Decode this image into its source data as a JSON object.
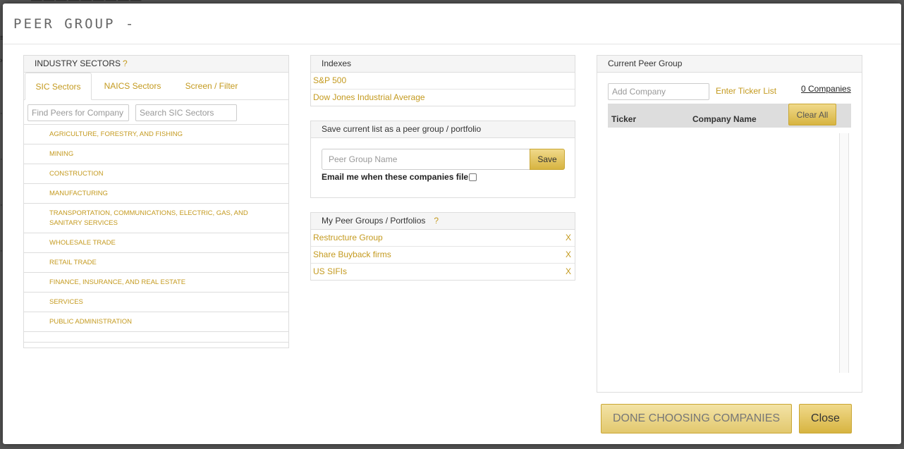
{
  "modal": {
    "title": "PEER GROUP -"
  },
  "industry": {
    "title": "INDUSTRY SECTORS",
    "help": "?",
    "tabs": [
      "SIC Sectors",
      "NAICS Sectors",
      "Screen / Filter"
    ],
    "find_peers_placeholder": "Find Peers for Company",
    "search_sic_placeholder": "Search SIC Sectors",
    "sectors": [
      "AGRICULTURE, FORESTRY, AND FISHING",
      "MINING",
      "CONSTRUCTION",
      "MANUFACTURING",
      "TRANSPORTATION, COMMUNICATIONS, ELECTRIC, GAS, AND SANITARY SERVICES",
      "WHOLESALE TRADE",
      "RETAIL TRADE",
      "FINANCE, INSURANCE, AND REAL ESTATE",
      "SERVICES",
      "PUBLIC ADMINISTRATION"
    ]
  },
  "indexes": {
    "title": "Indexes",
    "items": [
      "S&P 500",
      "Dow Jones Industrial Average"
    ]
  },
  "save_panel": {
    "title": "Save current list as a peer group / portfolio",
    "name_placeholder": "Peer Group Name",
    "save_label": "Save",
    "email_label": "Email me when these companies file"
  },
  "my_groups": {
    "title": "My Peer Groups / Portfolios",
    "help": "?",
    "items": [
      "Restructure Group",
      "Share Buyback firms",
      "US SIFIs"
    ],
    "remove_label": "X"
  },
  "current": {
    "title": "Current Peer Group",
    "add_placeholder": "Add Company",
    "ticker_list_label": "Enter Ticker List",
    "count_label": "0 Companies",
    "col_ticker": "Ticker",
    "col_company": "Company Name",
    "clear_label": "Clear All"
  },
  "footer": {
    "done_label": "DONE CHOOSING COMPANIES",
    "close_label": "Close"
  },
  "colors": {
    "accent": "#c49a1f",
    "button": "#e3c459"
  }
}
